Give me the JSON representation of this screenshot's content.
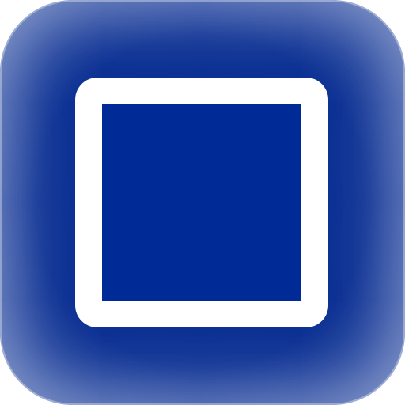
{
  "icon": {
    "name": "square-icon",
    "colors": {
      "background": "#0a2f93",
      "glyph_stroke": "#ffffff",
      "glyph_fill": "#002a96"
    }
  }
}
